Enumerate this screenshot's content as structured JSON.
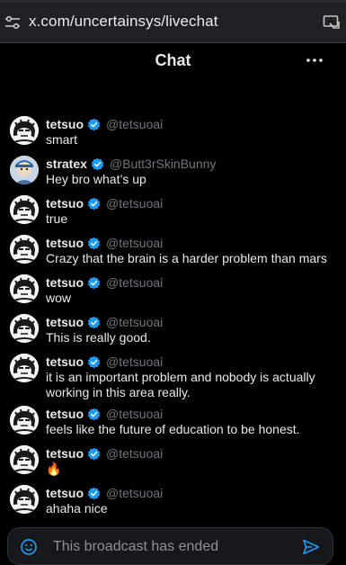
{
  "browser": {
    "url": "x.com/uncertainsys/livechat",
    "site_icon": "tune-icon",
    "cast_icon": "cast-icon"
  },
  "header": {
    "title": "Chat",
    "more_icon": "more-horizontal-icon"
  },
  "messages": [
    {
      "name": "tetsuo",
      "handle": "@tetsuoai",
      "text": "smart",
      "avatar": "tetsuo"
    },
    {
      "name": "stratex",
      "handle": "@Butt3rSkinBunny",
      "text": "Hey bro what’s up",
      "avatar": "stratex"
    },
    {
      "name": "tetsuo",
      "handle": "@tetsuoai",
      "text": "true",
      "avatar": "tetsuo"
    },
    {
      "name": "tetsuo",
      "handle": "@tetsuoai",
      "text": "Crazy that the brain is a harder problem than mars",
      "avatar": "tetsuo"
    },
    {
      "name": "tetsuo",
      "handle": "@tetsuoai",
      "text": "wow",
      "avatar": "tetsuo"
    },
    {
      "name": "tetsuo",
      "handle": "@tetsuoai",
      "text": "This is really good.",
      "avatar": "tetsuo"
    },
    {
      "name": "tetsuo",
      "handle": "@tetsuoai",
      "text": "it is an important problem and nobody is actually working in this area really.",
      "avatar": "tetsuo"
    },
    {
      "name": "tetsuo",
      "handle": "@tetsuoai",
      "text": "feels like the future of education to be honest.",
      "avatar": "tetsuo"
    },
    {
      "name": "tetsuo",
      "handle": "@tetsuoai",
      "text": "🔥",
      "avatar": "tetsuo"
    },
    {
      "name": "tetsuo",
      "handle": "@tetsuoai",
      "text": "ahaha nice",
      "avatar": "tetsuo"
    }
  ],
  "composer": {
    "placeholder": "This broadcast has ended",
    "emoji_icon": "emoji-icon",
    "send_icon": "send-icon"
  },
  "colors": {
    "background": "#000000",
    "accent": "#1d9bf0",
    "handle": "#71767b",
    "text": "#e7e9ea"
  }
}
